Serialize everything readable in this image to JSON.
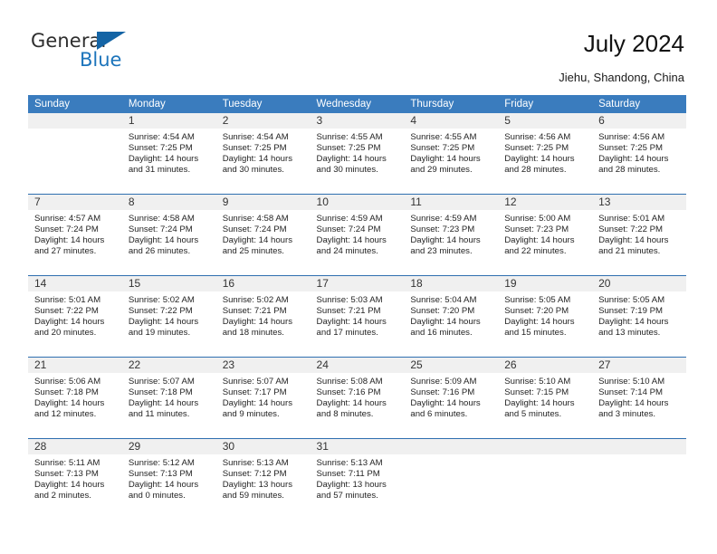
{
  "brand": {
    "name_part1": "General",
    "name_part2": "Blue",
    "triangle_color": "#1464a5",
    "blue_text_color": "#1c74bb"
  },
  "header": {
    "title": "July 2024",
    "subtitle": "Jiehu, Shandong, China"
  },
  "colors": {
    "header_row_background": "#3a7cbe",
    "header_row_text": "#ffffff",
    "daynum_background": "#f0f0f0",
    "week_separator": "#2f6fb0"
  },
  "weekday_headers": [
    "Sunday",
    "Monday",
    "Tuesday",
    "Wednesday",
    "Thursday",
    "Friday",
    "Saturday"
  ],
  "weeks": [
    [
      {
        "day": "",
        "sunrise": "",
        "sunset": "",
        "daylight_line1": "",
        "daylight_line2": ""
      },
      {
        "day": "1",
        "sunrise": "Sunrise: 4:54 AM",
        "sunset": "Sunset: 7:25 PM",
        "daylight_line1": "Daylight: 14 hours",
        "daylight_line2": "and 31 minutes."
      },
      {
        "day": "2",
        "sunrise": "Sunrise: 4:54 AM",
        "sunset": "Sunset: 7:25 PM",
        "daylight_line1": "Daylight: 14 hours",
        "daylight_line2": "and 30 minutes."
      },
      {
        "day": "3",
        "sunrise": "Sunrise: 4:55 AM",
        "sunset": "Sunset: 7:25 PM",
        "daylight_line1": "Daylight: 14 hours",
        "daylight_line2": "and 30 minutes."
      },
      {
        "day": "4",
        "sunrise": "Sunrise: 4:55 AM",
        "sunset": "Sunset: 7:25 PM",
        "daylight_line1": "Daylight: 14 hours",
        "daylight_line2": "and 29 minutes."
      },
      {
        "day": "5",
        "sunrise": "Sunrise: 4:56 AM",
        "sunset": "Sunset: 7:25 PM",
        "daylight_line1": "Daylight: 14 hours",
        "daylight_line2": "and 28 minutes."
      },
      {
        "day": "6",
        "sunrise": "Sunrise: 4:56 AM",
        "sunset": "Sunset: 7:25 PM",
        "daylight_line1": "Daylight: 14 hours",
        "daylight_line2": "and 28 minutes."
      }
    ],
    [
      {
        "day": "7",
        "sunrise": "Sunrise: 4:57 AM",
        "sunset": "Sunset: 7:24 PM",
        "daylight_line1": "Daylight: 14 hours",
        "daylight_line2": "and 27 minutes."
      },
      {
        "day": "8",
        "sunrise": "Sunrise: 4:58 AM",
        "sunset": "Sunset: 7:24 PM",
        "daylight_line1": "Daylight: 14 hours",
        "daylight_line2": "and 26 minutes."
      },
      {
        "day": "9",
        "sunrise": "Sunrise: 4:58 AM",
        "sunset": "Sunset: 7:24 PM",
        "daylight_line1": "Daylight: 14 hours",
        "daylight_line2": "and 25 minutes."
      },
      {
        "day": "10",
        "sunrise": "Sunrise: 4:59 AM",
        "sunset": "Sunset: 7:24 PM",
        "daylight_line1": "Daylight: 14 hours",
        "daylight_line2": "and 24 minutes."
      },
      {
        "day": "11",
        "sunrise": "Sunrise: 4:59 AM",
        "sunset": "Sunset: 7:23 PM",
        "daylight_line1": "Daylight: 14 hours",
        "daylight_line2": "and 23 minutes."
      },
      {
        "day": "12",
        "sunrise": "Sunrise: 5:00 AM",
        "sunset": "Sunset: 7:23 PM",
        "daylight_line1": "Daylight: 14 hours",
        "daylight_line2": "and 22 minutes."
      },
      {
        "day": "13",
        "sunrise": "Sunrise: 5:01 AM",
        "sunset": "Sunset: 7:22 PM",
        "daylight_line1": "Daylight: 14 hours",
        "daylight_line2": "and 21 minutes."
      }
    ],
    [
      {
        "day": "14",
        "sunrise": "Sunrise: 5:01 AM",
        "sunset": "Sunset: 7:22 PM",
        "daylight_line1": "Daylight: 14 hours",
        "daylight_line2": "and 20 minutes."
      },
      {
        "day": "15",
        "sunrise": "Sunrise: 5:02 AM",
        "sunset": "Sunset: 7:22 PM",
        "daylight_line1": "Daylight: 14 hours",
        "daylight_line2": "and 19 minutes."
      },
      {
        "day": "16",
        "sunrise": "Sunrise: 5:02 AM",
        "sunset": "Sunset: 7:21 PM",
        "daylight_line1": "Daylight: 14 hours",
        "daylight_line2": "and 18 minutes."
      },
      {
        "day": "17",
        "sunrise": "Sunrise: 5:03 AM",
        "sunset": "Sunset: 7:21 PM",
        "daylight_line1": "Daylight: 14 hours",
        "daylight_line2": "and 17 minutes."
      },
      {
        "day": "18",
        "sunrise": "Sunrise: 5:04 AM",
        "sunset": "Sunset: 7:20 PM",
        "daylight_line1": "Daylight: 14 hours",
        "daylight_line2": "and 16 minutes."
      },
      {
        "day": "19",
        "sunrise": "Sunrise: 5:05 AM",
        "sunset": "Sunset: 7:20 PM",
        "daylight_line1": "Daylight: 14 hours",
        "daylight_line2": "and 15 minutes."
      },
      {
        "day": "20",
        "sunrise": "Sunrise: 5:05 AM",
        "sunset": "Sunset: 7:19 PM",
        "daylight_line1": "Daylight: 14 hours",
        "daylight_line2": "and 13 minutes."
      }
    ],
    [
      {
        "day": "21",
        "sunrise": "Sunrise: 5:06 AM",
        "sunset": "Sunset: 7:18 PM",
        "daylight_line1": "Daylight: 14 hours",
        "daylight_line2": "and 12 minutes."
      },
      {
        "day": "22",
        "sunrise": "Sunrise: 5:07 AM",
        "sunset": "Sunset: 7:18 PM",
        "daylight_line1": "Daylight: 14 hours",
        "daylight_line2": "and 11 minutes."
      },
      {
        "day": "23",
        "sunrise": "Sunrise: 5:07 AM",
        "sunset": "Sunset: 7:17 PM",
        "daylight_line1": "Daylight: 14 hours",
        "daylight_line2": "and 9 minutes."
      },
      {
        "day": "24",
        "sunrise": "Sunrise: 5:08 AM",
        "sunset": "Sunset: 7:16 PM",
        "daylight_line1": "Daylight: 14 hours",
        "daylight_line2": "and 8 minutes."
      },
      {
        "day": "25",
        "sunrise": "Sunrise: 5:09 AM",
        "sunset": "Sunset: 7:16 PM",
        "daylight_line1": "Daylight: 14 hours",
        "daylight_line2": "and 6 minutes."
      },
      {
        "day": "26",
        "sunrise": "Sunrise: 5:10 AM",
        "sunset": "Sunset: 7:15 PM",
        "daylight_line1": "Daylight: 14 hours",
        "daylight_line2": "and 5 minutes."
      },
      {
        "day": "27",
        "sunrise": "Sunrise: 5:10 AM",
        "sunset": "Sunset: 7:14 PM",
        "daylight_line1": "Daylight: 14 hours",
        "daylight_line2": "and 3 minutes."
      }
    ],
    [
      {
        "day": "28",
        "sunrise": "Sunrise: 5:11 AM",
        "sunset": "Sunset: 7:13 PM",
        "daylight_line1": "Daylight: 14 hours",
        "daylight_line2": "and 2 minutes."
      },
      {
        "day": "29",
        "sunrise": "Sunrise: 5:12 AM",
        "sunset": "Sunset: 7:13 PM",
        "daylight_line1": "Daylight: 14 hours",
        "daylight_line2": "and 0 minutes."
      },
      {
        "day": "30",
        "sunrise": "Sunrise: 5:13 AM",
        "sunset": "Sunset: 7:12 PM",
        "daylight_line1": "Daylight: 13 hours",
        "daylight_line2": "and 59 minutes."
      },
      {
        "day": "31",
        "sunrise": "Sunrise: 5:13 AM",
        "sunset": "Sunset: 7:11 PM",
        "daylight_line1": "Daylight: 13 hours",
        "daylight_line2": "and 57 minutes."
      },
      {
        "day": "",
        "sunrise": "",
        "sunset": "",
        "daylight_line1": "",
        "daylight_line2": ""
      },
      {
        "day": "",
        "sunrise": "",
        "sunset": "",
        "daylight_line1": "",
        "daylight_line2": ""
      },
      {
        "day": "",
        "sunrise": "",
        "sunset": "",
        "daylight_line1": "",
        "daylight_line2": ""
      }
    ]
  ]
}
